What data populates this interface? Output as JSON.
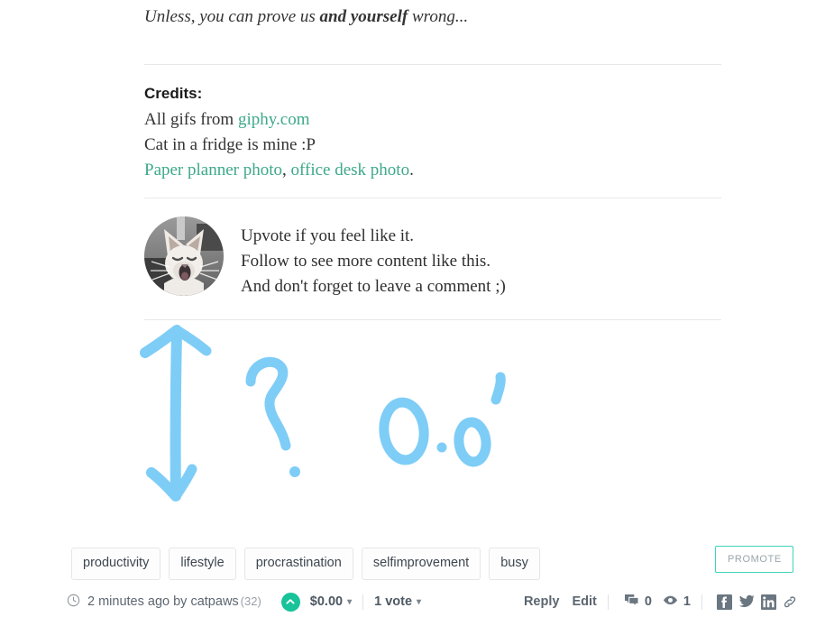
{
  "post": {
    "tagline_prefix": "Unless, you can prove us ",
    "tagline_bold": "and yourself",
    "tagline_suffix": " wrong...",
    "credits_heading": "Credits:",
    "credits_line1_prefix": "All gifs from ",
    "credits_line1_link": "giphy.com",
    "credits_line2": "Cat in a fridge is mine :P",
    "credits_line3_link1": "Paper planner photo",
    "credits_line3_sep": ", ",
    "credits_line3_link2": "office desk photo",
    "credits_line3_end": ".",
    "follow_line1": "Upvote if you feel like it.",
    "follow_line2": "Follow to see more content like this.",
    "follow_line3": "And don't forget to leave a comment ;)",
    "avatar_alt": "cat-avatar"
  },
  "doodle": {
    "stroke_color": "#7ecdf7",
    "description": "hand-drawn double-headed arrow, question mark and 0.0 face"
  },
  "tags": [
    "productivity",
    "lifestyle",
    "procrastination",
    "selfimprovement",
    "busy"
  ],
  "promote": {
    "label": "PROMOTE",
    "border_color": "#3fd3bc"
  },
  "footer": {
    "time": "2 minutes ago by",
    "author": "catpaws",
    "reputation": "(32)",
    "payout": "$0.00",
    "votes": "1 vote",
    "reply_label": "Reply",
    "edit_label": "Edit",
    "comment_count": "0",
    "view_count": "1",
    "upvote_color": "#18c39a",
    "caret": "▾"
  },
  "colors": {
    "link_green": "#3da88a",
    "text_dark": "#2f2f2f",
    "muted": "#5c6670"
  }
}
